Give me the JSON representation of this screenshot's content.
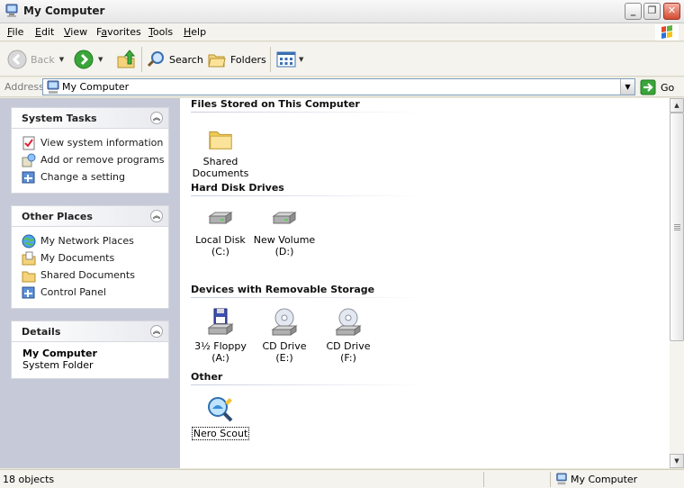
{
  "window": {
    "title": "My Computer"
  },
  "menu": {
    "items": [
      {
        "label": "File",
        "key": "F",
        "rest": "ile"
      },
      {
        "label": "Edit",
        "key": "E",
        "rest": "dit"
      },
      {
        "label": "View",
        "key": "V",
        "rest": "iew"
      },
      {
        "label": "Favorites",
        "key": "a",
        "pre": "F",
        "rest": "vorites"
      },
      {
        "label": "Tools",
        "key": "T",
        "rest": "ools"
      },
      {
        "label": "Help",
        "key": "H",
        "rest": "elp"
      }
    ]
  },
  "toolbar": {
    "back_label": "Back",
    "search_label": "Search",
    "folders_label": "Folders"
  },
  "address": {
    "label": "Address",
    "value": "My Computer",
    "go_label": "Go"
  },
  "taskpane": {
    "system_tasks": {
      "title": "System Tasks",
      "items": [
        "View system information",
        "Add or remove programs",
        "Change a setting"
      ]
    },
    "other_places": {
      "title": "Other Places",
      "items": [
        "My Network Places",
        "My Documents",
        "Shared Documents",
        "Control Panel"
      ]
    },
    "details": {
      "title": "Details",
      "name": "My Computer",
      "type": "System Folder"
    }
  },
  "content": {
    "groups": [
      {
        "title": "Files Stored on This Computer",
        "items": [
          {
            "line1": "Shared",
            "line2": "Documents",
            "icon": "folder-icon"
          }
        ]
      },
      {
        "title": "Hard Disk Drives",
        "items": [
          {
            "line1": "Local Disk (C:)",
            "line2": "",
            "icon": "hard-disk-icon"
          },
          {
            "line1": "New Volume",
            "line2": "(D:)",
            "icon": "hard-disk-icon"
          }
        ]
      },
      {
        "title": "Devices with Removable Storage",
        "items": [
          {
            "line1": "3½ Floppy",
            "line2": "(A:)",
            "icon": "floppy-drive-icon"
          },
          {
            "line1": "CD Drive (E:)",
            "line2": "",
            "icon": "cd-drive-icon"
          },
          {
            "line1": "CD Drive (F:)",
            "line2": "",
            "icon": "cd-drive-icon"
          }
        ]
      },
      {
        "title": "Other",
        "items": [
          {
            "line1": "Nero Scout",
            "line2": "",
            "icon": "nero-scout-icon"
          }
        ]
      }
    ]
  },
  "status": {
    "count": "18 objects",
    "location": "My Computer"
  }
}
